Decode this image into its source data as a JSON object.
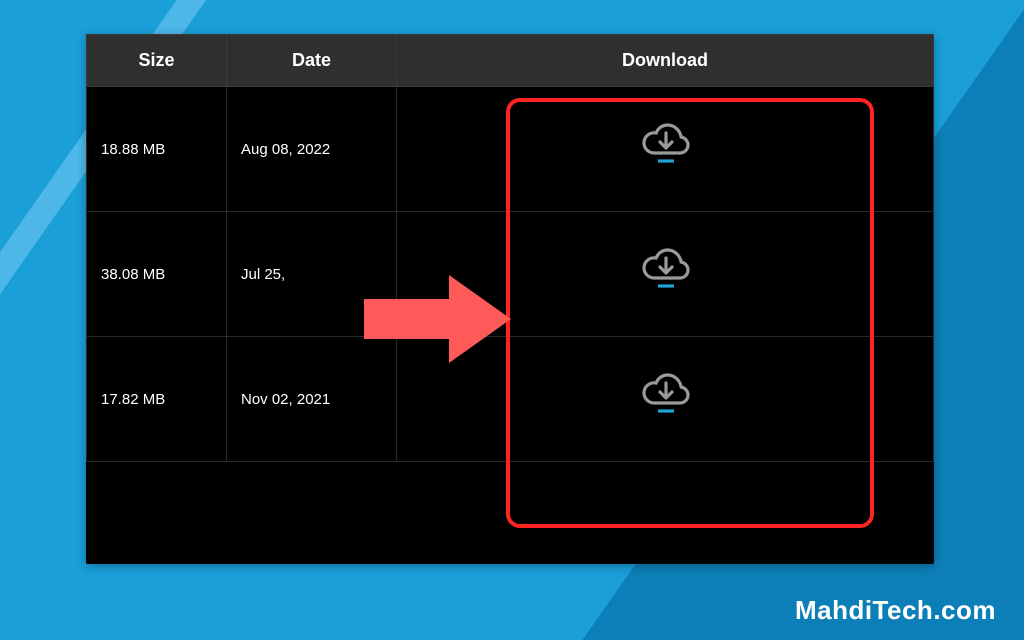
{
  "table": {
    "headers": {
      "size": "Size",
      "date": "Date",
      "download": "Download"
    },
    "rows": [
      {
        "size": "18.88 MB",
        "date": "Aug 08, 2022"
      },
      {
        "size": "38.08 MB",
        "date": "Jul 25,"
      },
      {
        "size": "17.82 MB",
        "date": "Nov 02, 2021"
      }
    ]
  },
  "watermark": "MahdiTech.com",
  "colors": {
    "highlight": "#ff2424",
    "arrow": "#ff5a5a",
    "cloud_stroke": "#9a9a9a",
    "underline": "#1fa4d8"
  }
}
